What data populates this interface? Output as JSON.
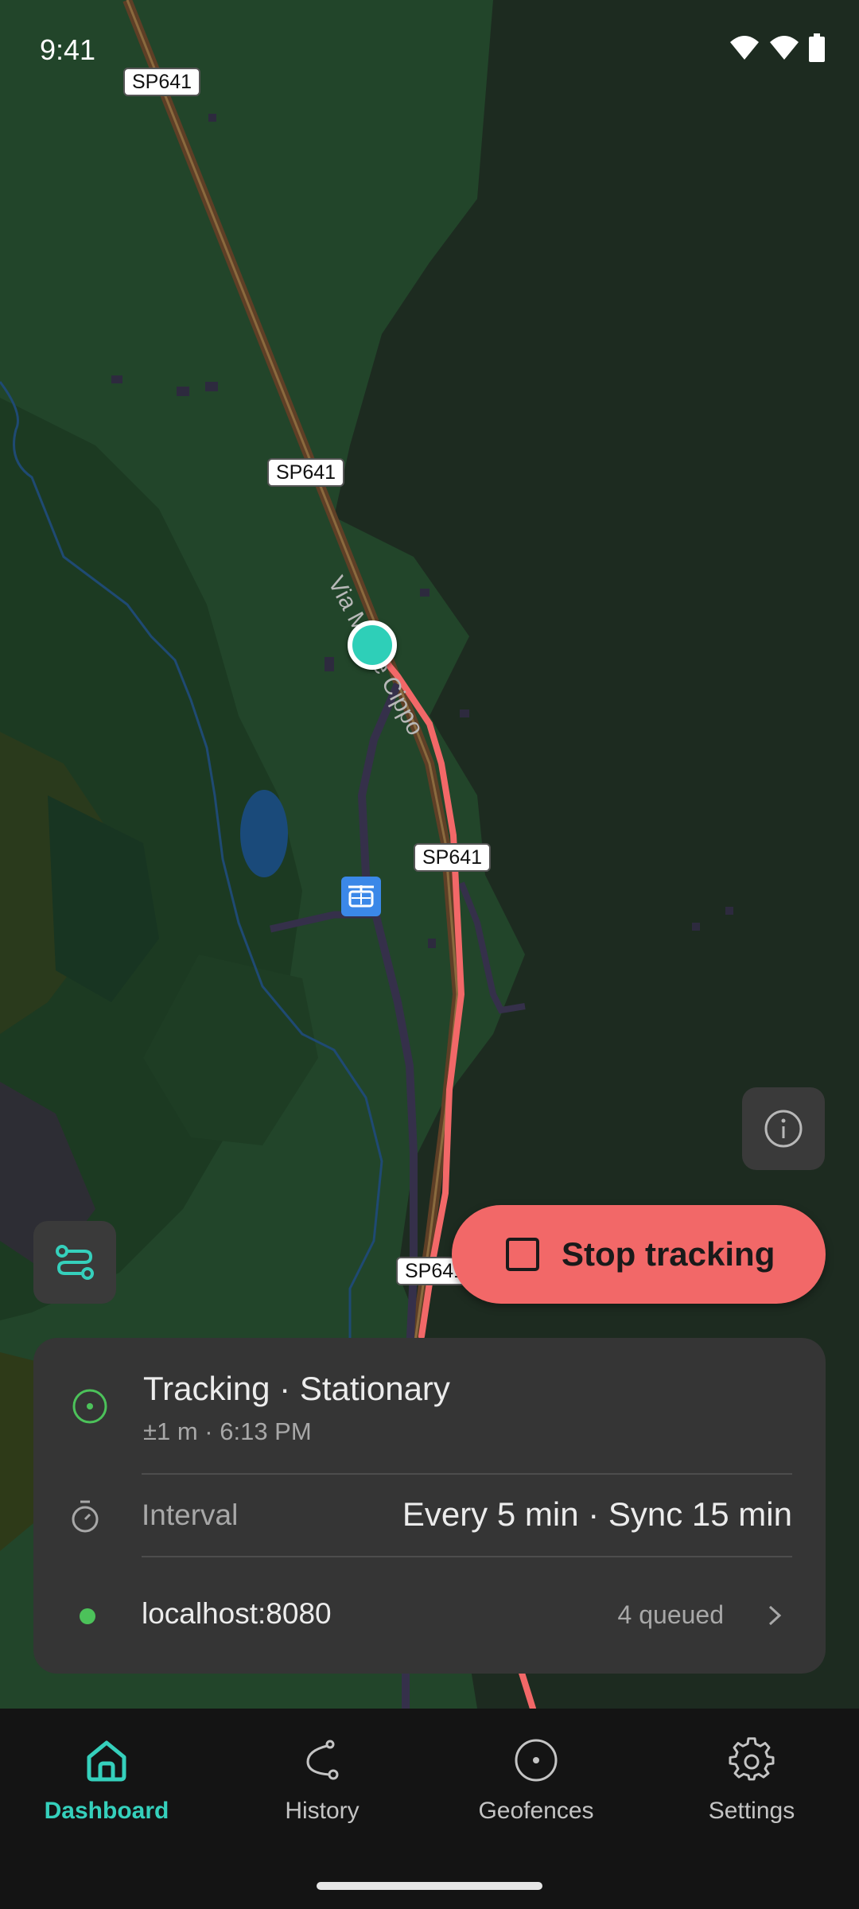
{
  "status_bar": {
    "time": "9:41",
    "icons": [
      "wifi-icon",
      "wifi-icon",
      "battery-icon"
    ]
  },
  "map": {
    "road_shields": [
      "SP641",
      "SP641",
      "SP641",
      "SP641"
    ],
    "road_name": "Via Monte Cippo",
    "poi_icon": "cable-car-icon",
    "colors": {
      "forest": "#1f3a24",
      "forest_dark": "#1a2b1d",
      "road_main": "#6b4a2e",
      "track": "#f26868",
      "location": "#2ecfb8",
      "water": "#1a4a7a"
    }
  },
  "controls": {
    "info_icon": "info-icon",
    "route_icon": "route-icon",
    "stop_button_label": "Stop tracking",
    "stop_icon": "stop-square-icon"
  },
  "status_card": {
    "title": "Tracking · Stationary",
    "subtitle": "±1 m · 6:13 PM",
    "interval_label": "Interval",
    "interval_value": "Every 5 min · Sync 15 min",
    "server": "localhost:8080",
    "queue": "4 queued",
    "status_color": "#4cc25a"
  },
  "nav": {
    "items": [
      {
        "label": "Dashboard",
        "icon": "home-icon"
      },
      {
        "label": "History",
        "icon": "history-route-icon"
      },
      {
        "label": "Geofences",
        "icon": "geofence-icon"
      },
      {
        "label": "Settings",
        "icon": "gear-icon"
      }
    ],
    "active": "Dashboard",
    "accent": "#35d0bc"
  }
}
